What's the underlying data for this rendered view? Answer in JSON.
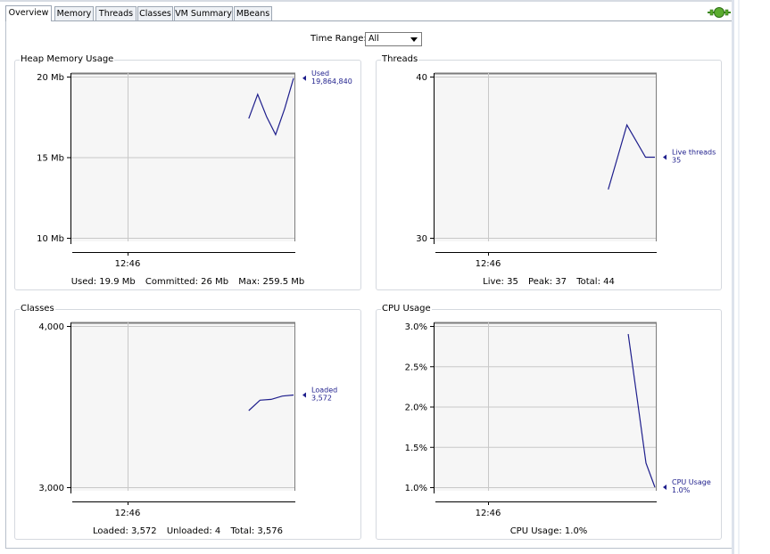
{
  "tabs": [
    {
      "label": "Overview",
      "active": true
    },
    {
      "label": "Memory",
      "active": false
    },
    {
      "label": "Threads",
      "active": false
    },
    {
      "label": "Classes",
      "active": false
    },
    {
      "label": "VM Summary",
      "active": false
    },
    {
      "label": "MBeans",
      "active": false
    }
  ],
  "connection_icon": "connection-status-icon",
  "time_range": {
    "label": "Time Range:",
    "selected": "All"
  },
  "colors": {
    "series": "#1e1e8c",
    "grid": "#c8c8c8",
    "border": "#d5d9df"
  },
  "panels": {
    "heap": {
      "title": "Heap Memory Usage",
      "footer": {
        "used": "Used: 19.9 Mb",
        "committed": "Committed: 26 Mb",
        "max": "Max: 259.5 Mb"
      }
    },
    "threads": {
      "title": "Threads",
      "footer": {
        "live": "Live: 35",
        "peak": "Peak: 37",
        "total": "Total: 44"
      }
    },
    "classes": {
      "title": "Classes",
      "footer": {
        "loaded": "Loaded: 3,572",
        "unloaded": "Unloaded: 4",
        "total": "Total: 3,576"
      }
    },
    "cpu": {
      "title": "CPU Usage",
      "footer": {
        "usage": "CPU Usage: 1.0%"
      }
    }
  },
  "chart_data": [
    {
      "type": "line",
      "title": "Heap Memory Usage",
      "xlabel": "",
      "ylabel": "",
      "x_ticks": [
        "12:46"
      ],
      "y_ticks": [
        "10 Mb",
        "15 Mb",
        "20 Mb"
      ],
      "ylim": [
        10,
        20
      ],
      "grid": true,
      "series": [
        {
          "name": "Used",
          "color": "#1e1e8c",
          "values": [
            17.4,
            18.9,
            17.5,
            16.4,
            18.0,
            19.9
          ]
        }
      ],
      "end_label": {
        "name": "Used",
        "value": "19,864,840"
      }
    },
    {
      "type": "line",
      "title": "Threads",
      "xlabel": "",
      "ylabel": "",
      "x_ticks": [
        "12:46"
      ],
      "y_ticks": [
        "30",
        "40"
      ],
      "ylim": [
        30,
        40
      ],
      "grid": true,
      "series": [
        {
          "name": "Live threads",
          "color": "#1e1e8c",
          "values": [
            33.0,
            35.0,
            37.0,
            36.0,
            35.0,
            35.0
          ]
        }
      ],
      "end_label": {
        "name": "Live threads",
        "value": "35"
      }
    },
    {
      "type": "line",
      "title": "Classes",
      "xlabel": "",
      "ylabel": "",
      "x_ticks": [
        "12:46"
      ],
      "y_ticks": [
        "3,000",
        "4,000"
      ],
      "ylim": [
        3000,
        4000
      ],
      "grid": true,
      "series": [
        {
          "name": "Loaded",
          "color": "#1e1e8c",
          "values": [
            3475,
            3540,
            3545,
            3565,
            3572
          ]
        }
      ],
      "end_label": {
        "name": "Loaded",
        "value": "3,572"
      }
    },
    {
      "type": "line",
      "title": "CPU Usage",
      "xlabel": "",
      "ylabel": "",
      "x_ticks": [
        "12:46"
      ],
      "y_ticks": [
        "1.0%",
        "1.5%",
        "2.0%",
        "2.5%",
        "3.0%"
      ],
      "ylim": [
        1.0,
        3.0
      ],
      "grid": true,
      "series": [
        {
          "name": "CPU Usage",
          "color": "#1e1e8c",
          "values": [
            2.9,
            2.1,
            1.3,
            1.0
          ]
        }
      ],
      "end_label": {
        "name": "CPU Usage",
        "value": "1.0%"
      }
    }
  ]
}
